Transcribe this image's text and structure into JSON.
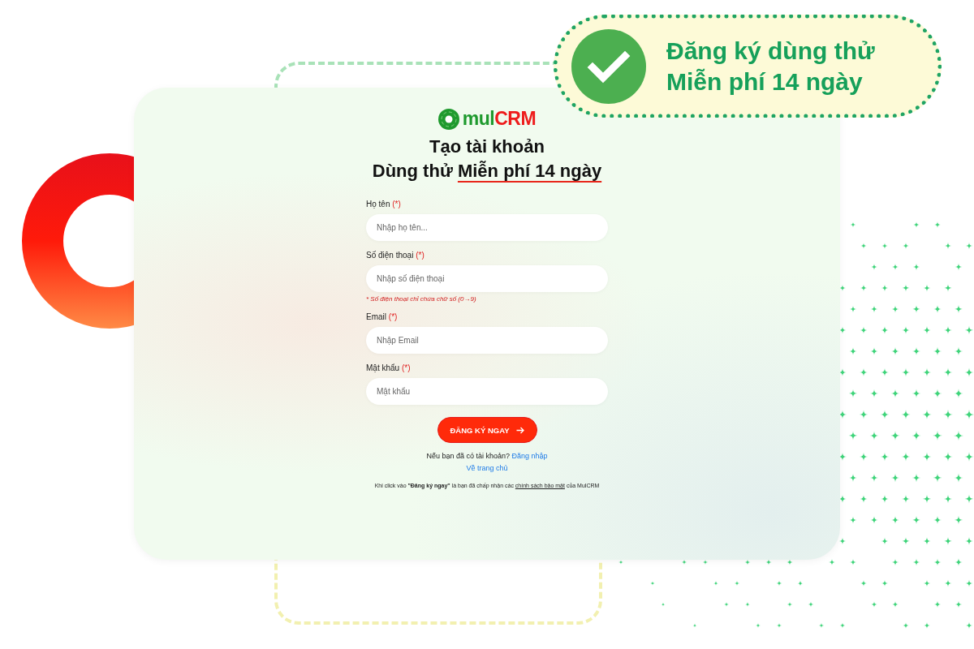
{
  "badge": {
    "lines": [
      "Đăng ký dùng thử",
      "Miễn phí 14 ngày"
    ]
  },
  "logo": {
    "prefix": "mul",
    "suffix": "CRM"
  },
  "heading": {
    "title": "Tạo tài khoản",
    "subtitle_lead": "Dùng thử",
    "subtitle_highlight": "Miễn phí 14 ngày"
  },
  "fields": [
    {
      "label": "Họ tên",
      "required_mark": "(*)",
      "placeholder": "Nhập họ tên..."
    },
    {
      "label": "Số điện thoại",
      "required_mark": "(*)",
      "placeholder": "Nhập số điện thoại",
      "hint": "* Số điện thoại chỉ chứa chữ số (0→9)"
    },
    {
      "label": "Email",
      "required_mark": "(*)",
      "placeholder": "Nhập Email"
    },
    {
      "label": "Mật khẩu",
      "required_mark": "(*)",
      "placeholder": "Mật khẩu"
    }
  ],
  "submit_button": {
    "label": "ĐĂNG KÝ NGAY"
  },
  "login_prompt": {
    "text": "Nếu bạn đã có tài khoản?",
    "link": "Đăng nhập"
  },
  "home_link": "Về trang chủ",
  "terms": {
    "before": "Khi click vào **\"Đăng ký ngay\"** là bạn đã chấp nhận các",
    "link": "chính sách bảo mật",
    "after": "của MulCRM"
  }
}
